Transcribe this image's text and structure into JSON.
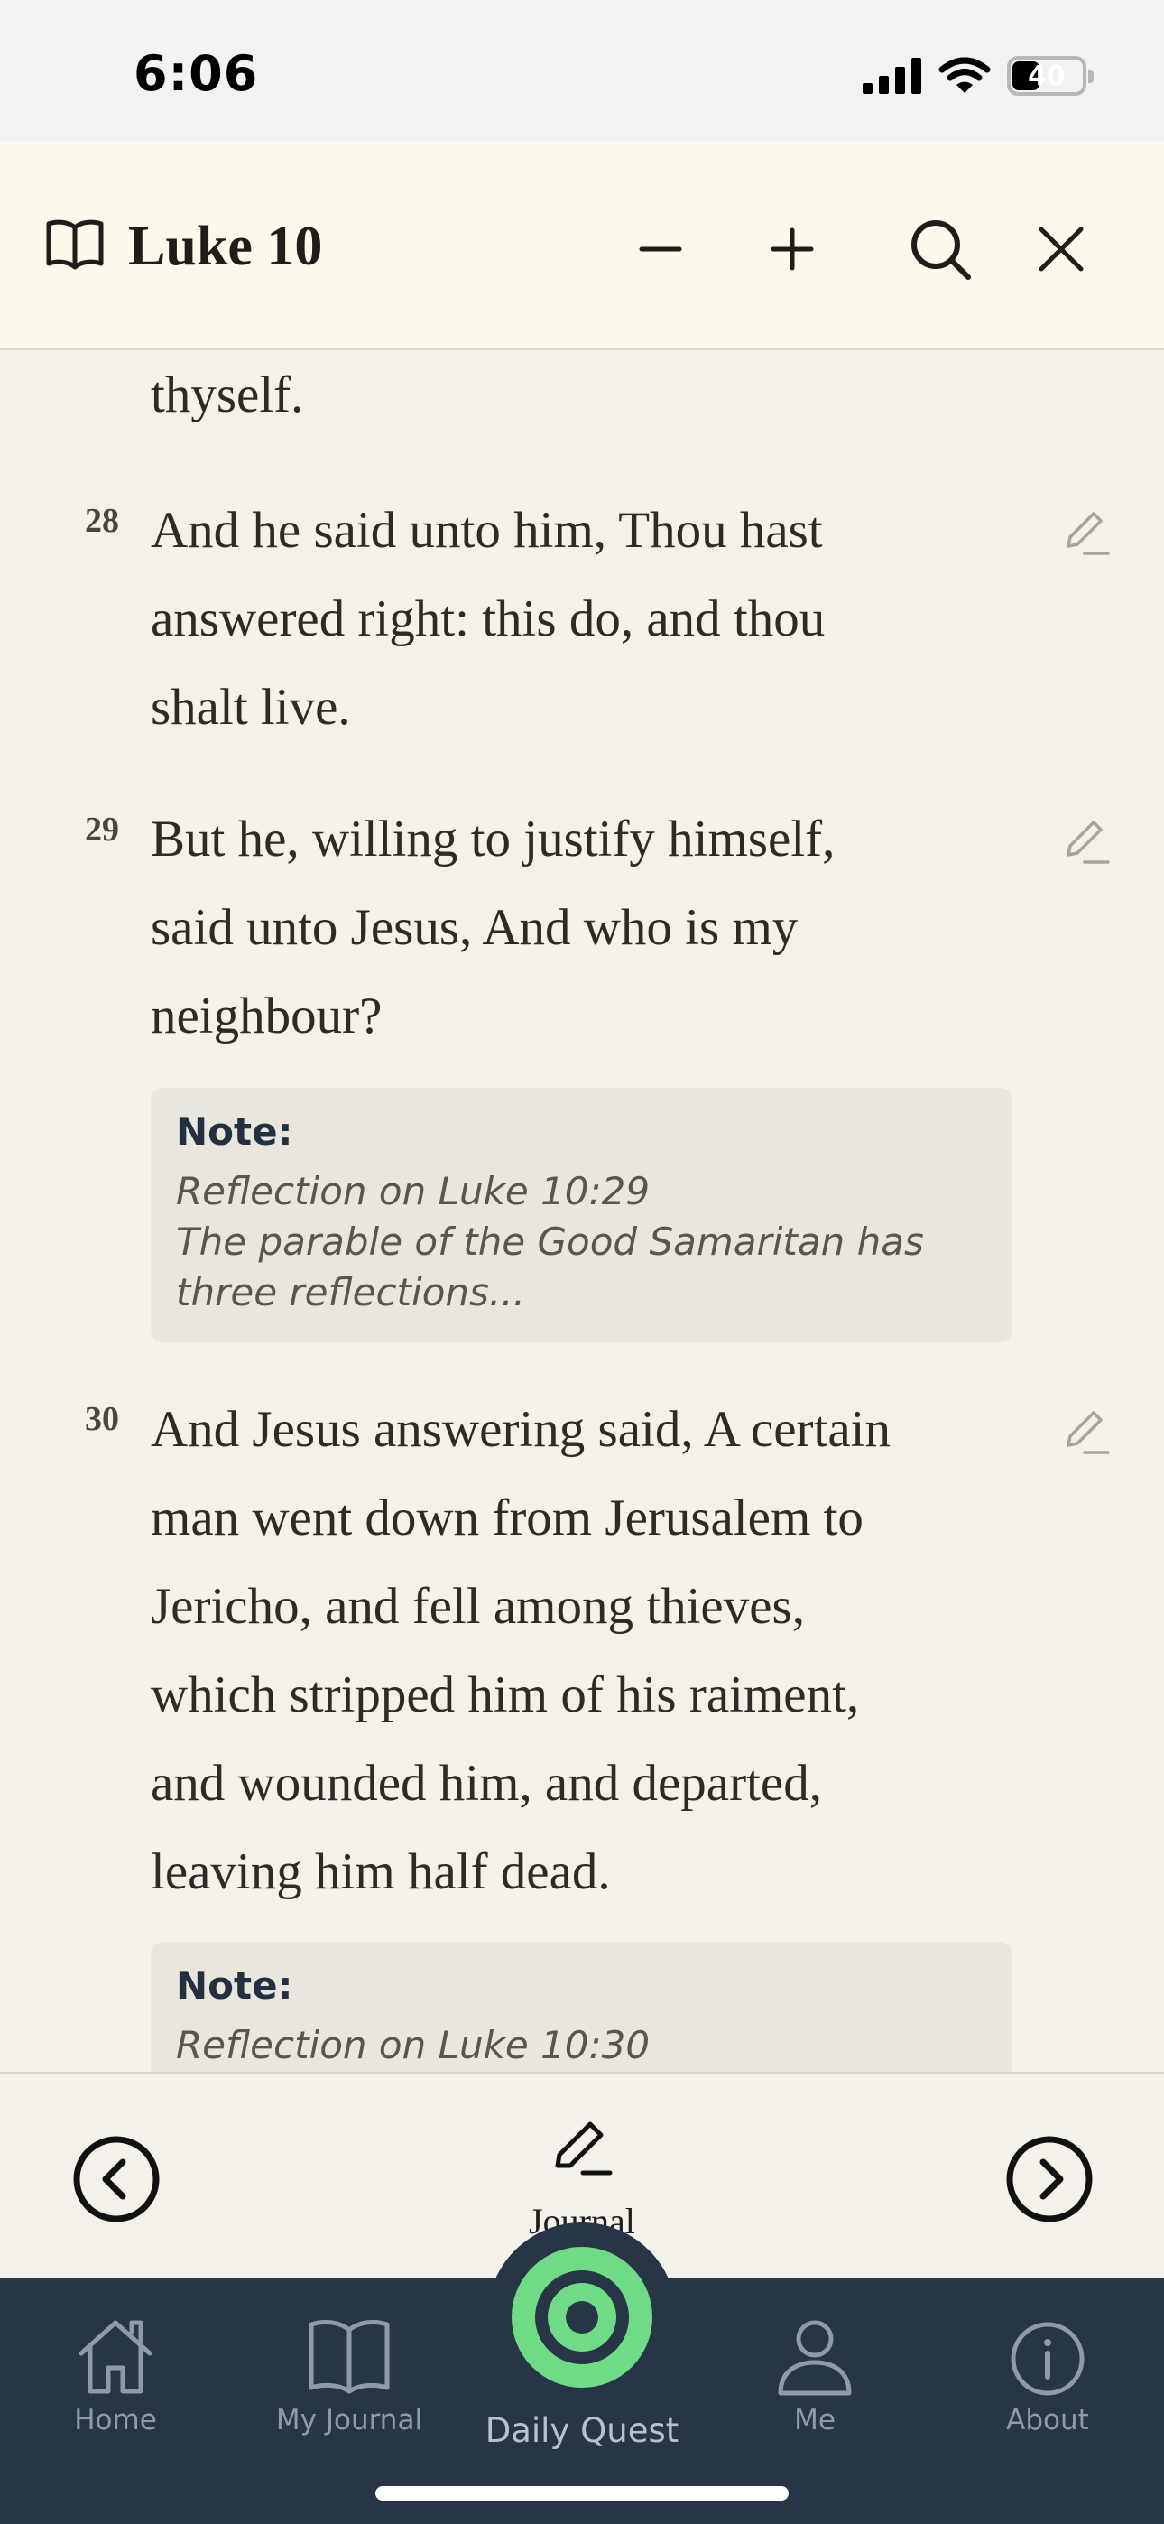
{
  "status_bar": {
    "time": "6:06",
    "battery": "40",
    "battery_level": 0.4
  },
  "header": {
    "title": "Luke 10",
    "icons": [
      "book-icon",
      "minus-icon",
      "plus-icon",
      "search-icon",
      "close-icon"
    ]
  },
  "passage": {
    "prev_tail": "thyself.",
    "verses": [
      {
        "number": "28",
        "lines": [
          "And he said unto him, Thou hast",
          "answered right: this do, and thou",
          "shalt live."
        ]
      },
      {
        "number": "29",
        "lines": [
          "But he, willing to justify himself,",
          "said unto Jesus, And who is my",
          "neighbour?"
        ]
      },
      {
        "number": "30",
        "lines": [
          "And Jesus answering said, A certain",
          "man went down from Jerusalem to",
          "Jericho, and fell among thieves,",
          "which stripped him of his raiment,",
          "and wounded him, and departed,",
          "leaving him half dead."
        ]
      }
    ],
    "notes": [
      {
        "label": "Note:",
        "lines": [
          "Reflection on Luke 10:29",
          "The parable of the Good Samaritan has",
          "three reflections..."
        ]
      },
      {
        "label": "Note:",
        "lines": [
          "Reflection on Luke 10:30"
        ]
      }
    ]
  },
  "action_bar": {
    "journal_label": "Journal",
    "icons": [
      "chevron-left-circle-icon",
      "pencil-icon",
      "chevron-right-circle-icon"
    ]
  },
  "tab_bar": {
    "tabs": [
      {
        "label": "Home",
        "icon": "home-icon"
      },
      {
        "label": "My Journal",
        "icon": "open-book-icon"
      },
      {
        "label": "Daily Quest",
        "icon": "target-icon"
      },
      {
        "label": "Me",
        "icon": "person-icon"
      },
      {
        "label": "About",
        "icon": "info-icon"
      }
    ]
  },
  "colors": {
    "tab_bar": "#283547",
    "quest_accent": "#6fdb86",
    "paper": "#f4f1ea",
    "header": "#fcf8ec"
  }
}
